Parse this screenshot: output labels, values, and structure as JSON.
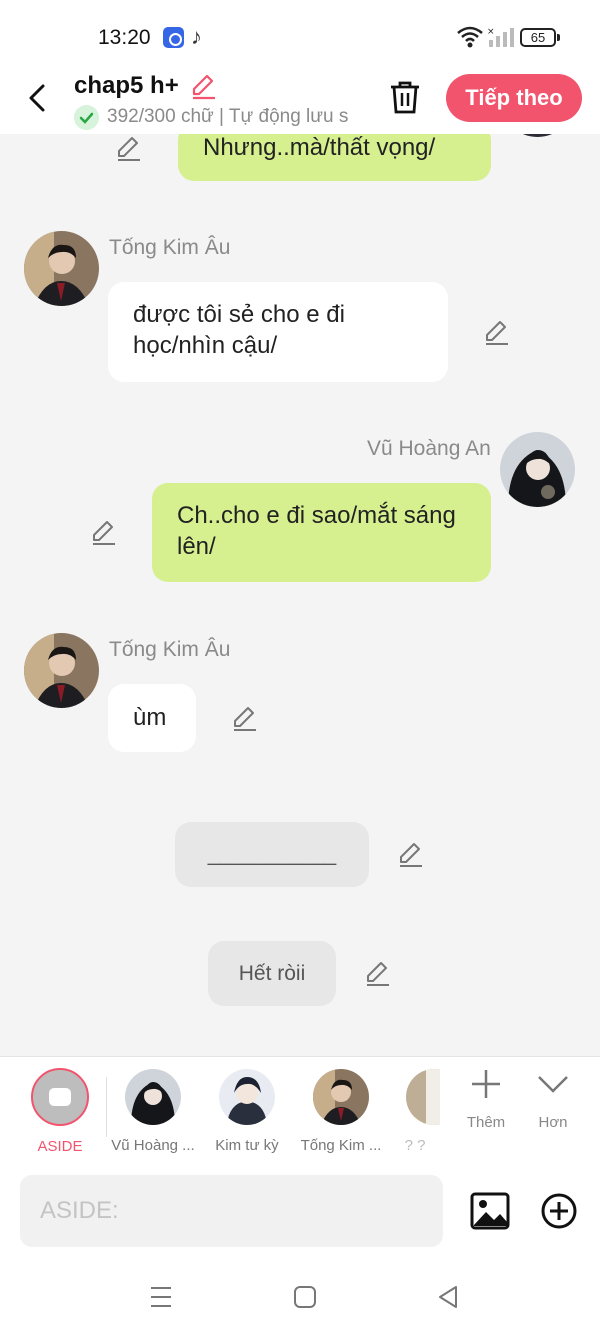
{
  "status_bar": {
    "time": "13:20",
    "battery": "65"
  },
  "header": {
    "title": "chap5 h+",
    "subtitle": "392/300 chữ | Tự động lưu s",
    "next_label": "Tiếp theo"
  },
  "messages": [
    {
      "speaker": "",
      "text": "Nhưng..mà/thất vọng/"
    },
    {
      "speaker": "Tống Kim Âu",
      "text": "được tôi sẻ cho e đi học/nhìn cậu/"
    },
    {
      "speaker": "Vũ Hoàng An",
      "text": "Ch..cho e đi sao/mắt sáng lên/"
    },
    {
      "speaker": "Tống Kim Âu",
      "text": "ùm"
    },
    {
      "speaker": "",
      "text": "___________"
    },
    {
      "speaker": "",
      "text": "Hết ròii"
    }
  ],
  "characters": [
    {
      "label": "ASIDE"
    },
    {
      "label": "Vũ Hoàng ..."
    },
    {
      "label": "Kim tư kỳ"
    },
    {
      "label": "Tống Kim ..."
    },
    {
      "label": "? ?"
    }
  ],
  "utilities": {
    "add_label": "Thêm",
    "more_label": "Hơn"
  },
  "input": {
    "placeholder": "ASIDE:"
  },
  "colors": {
    "accent": "#f2546e",
    "green_bubble": "#d6f08f",
    "white_bubble": "#ffffff"
  }
}
